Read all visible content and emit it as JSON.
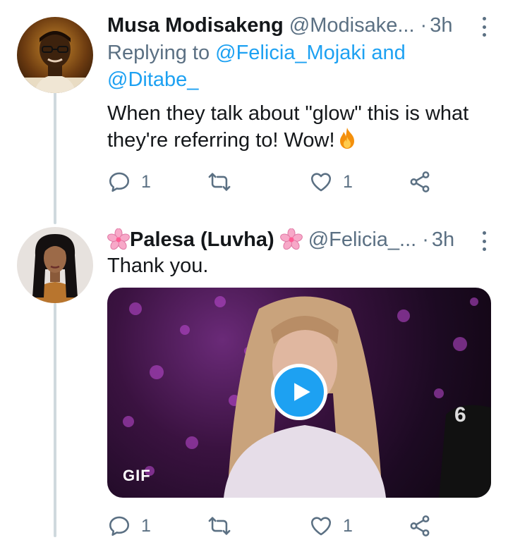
{
  "tweets": [
    {
      "display_name": "Musa Modisakeng",
      "handle": "@Modisake...",
      "separator": "·",
      "time": "3h",
      "reply_prefix": "Replying to",
      "reply_mention_1": "@Felicia_Mojaki",
      "reply_conjunction": "and",
      "reply_mention_2": "@Ditabe_",
      "text": "When they talk about \"glow\" this is what they're referring to! Wow!",
      "text_emoji": "fire-emoji",
      "actions": {
        "reply_count": "1",
        "retweet_count": "",
        "like_count": "1"
      }
    },
    {
      "display_name": "Palesa (Luvha)",
      "name_emoji": "cherry-blossom-emoji",
      "handle": "@Felicia_...",
      "separator": "·",
      "time": "3h",
      "text": "Thank you.",
      "media": {
        "type": "gif",
        "badge": "GIF",
        "play_icon": "play-icon"
      },
      "actions": {
        "reply_count": "1",
        "retweet_count": "",
        "like_count": "1"
      }
    }
  ],
  "icons": [
    "reply-icon",
    "retweet-icon",
    "like-icon",
    "share-icon",
    "more-options-icon"
  ],
  "colors": {
    "accent": "#1da1f2",
    "text_primary": "#14171a",
    "text_secondary": "#5b7083",
    "thread_line": "#cfd9de"
  }
}
